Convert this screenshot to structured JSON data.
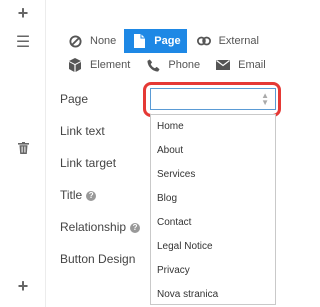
{
  "link_types": {
    "none": {
      "label": "None",
      "icon": "ban-icon"
    },
    "page": {
      "label": "Page",
      "icon": "page-icon"
    },
    "external": {
      "label": "External",
      "icon": "link-icon"
    },
    "element": {
      "label": "Element",
      "icon": "cube-icon"
    },
    "phone": {
      "label": "Phone",
      "icon": "phone-icon"
    },
    "email": {
      "label": "Email",
      "icon": "envelope-icon"
    }
  },
  "fields": {
    "page": "Page",
    "link_text": "Link text",
    "link_target": "Link target",
    "title": "Title",
    "relationship": "Relationship",
    "button_design": "Button Design"
  },
  "page_select": {
    "value": ""
  },
  "dropdown_options": [
    "Home",
    "About",
    "Services",
    "Blog",
    "Contact",
    "Legal Notice",
    "Privacy",
    "Nova stranica"
  ],
  "colors": {
    "accent": "#1e88e5",
    "highlight": "#e53935"
  }
}
